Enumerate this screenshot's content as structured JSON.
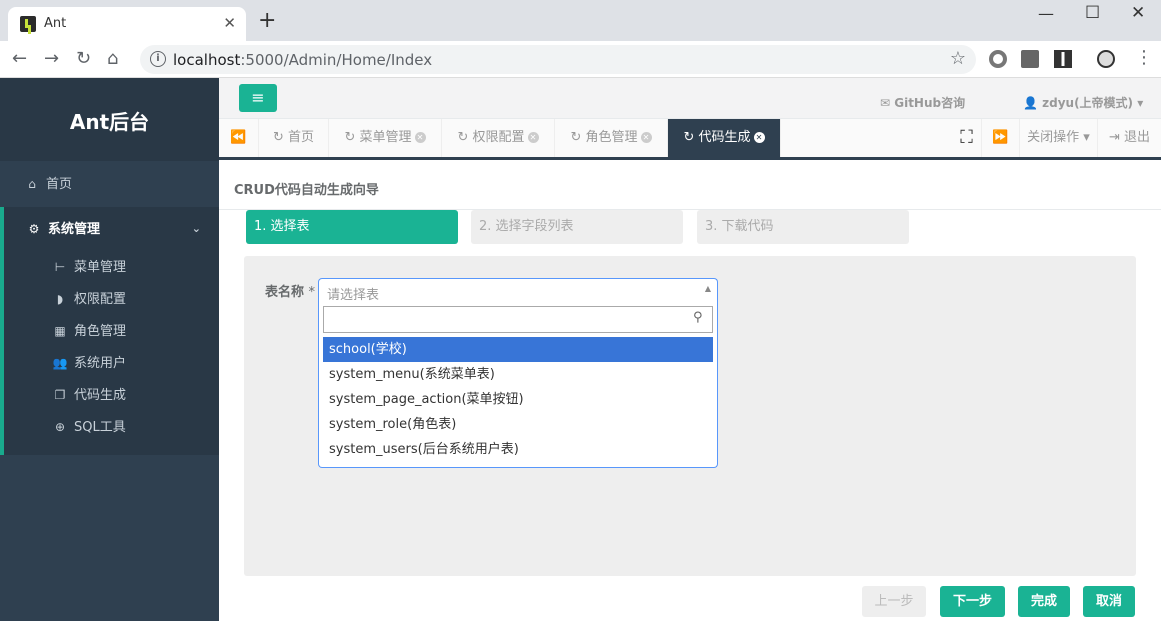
{
  "browser": {
    "tab_title": "Ant",
    "url_host": "localhost",
    "url_path": ":5000/Admin/Home/Index"
  },
  "sidebar": {
    "brand": "Ant后台",
    "home_label": "首页",
    "group_label": "系统管理",
    "items": [
      {
        "icon": "menu-tree-icon",
        "label": "菜单管理"
      },
      {
        "icon": "shield-icon",
        "label": "权限配置"
      },
      {
        "icon": "grid-icon",
        "label": "角色管理"
      },
      {
        "icon": "users-icon",
        "label": "系统用户"
      },
      {
        "icon": "copy-icon",
        "label": "代码生成"
      },
      {
        "icon": "zoom-icon",
        "label": "SQL工具"
      }
    ]
  },
  "header": {
    "github_label": "GitHub咨询",
    "user_label": "zdyu(上帝模式)"
  },
  "tabs": {
    "items": [
      {
        "label": "首页",
        "closable": false,
        "active": false
      },
      {
        "label": "菜单管理",
        "closable": true,
        "active": false
      },
      {
        "label": "权限配置",
        "closable": true,
        "active": false
      },
      {
        "label": "角色管理",
        "closable": true,
        "active": false
      },
      {
        "label": "代码生成",
        "closable": true,
        "active": true
      }
    ],
    "close_ops_label": "关闭操作",
    "logout_label": "退出"
  },
  "main": {
    "title": "CRUD代码自动生成向导",
    "steps": [
      "1. 选择表",
      "2. 选择字段列表",
      "3. 下载代码"
    ],
    "current_step": 0,
    "field_label": "表名称",
    "required_mark": "*",
    "select_placeholder": "请选择表",
    "search_value": "",
    "options": [
      "school(学校)",
      "system_menu(系统菜单表)",
      "system_page_action(菜单按钮)",
      "system_role(角色表)",
      "system_users(后台系统用户表)"
    ],
    "highlighted_option": 0,
    "buttons": {
      "prev": "上一步",
      "next": "下一步",
      "finish": "完成",
      "cancel": "取消"
    }
  },
  "colors": {
    "accent": "#1ab394",
    "sidebar": "#2f4050",
    "highlight": "#3875d7"
  }
}
